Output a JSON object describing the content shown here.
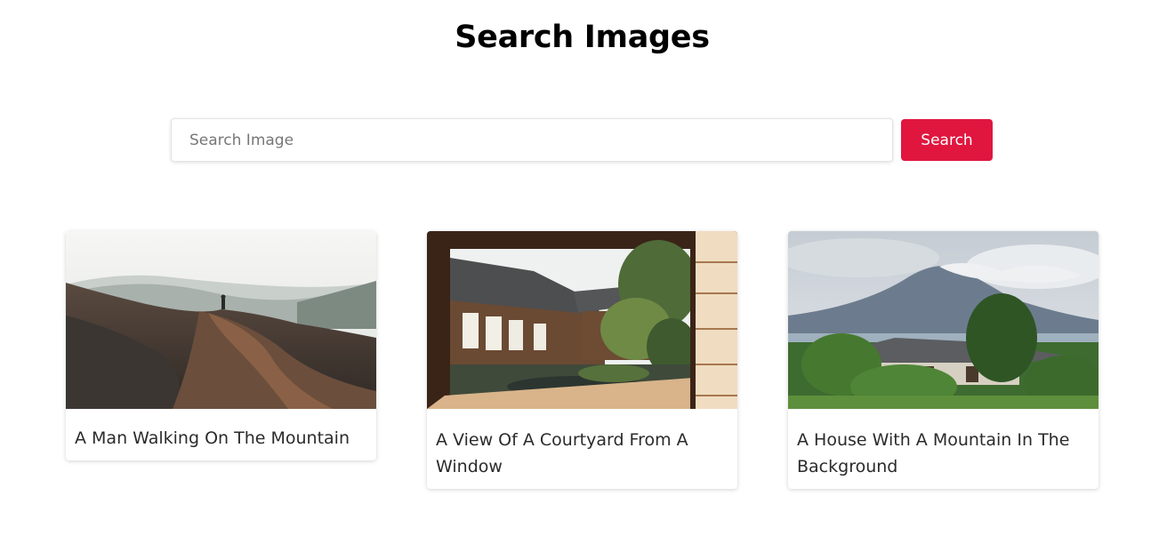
{
  "page": {
    "title": "Search Images"
  },
  "search": {
    "placeholder": "Search Image",
    "value": "",
    "button_label": "Search"
  },
  "colors": {
    "accent": "#e0163f",
    "title": "#000000",
    "caption": "#2b2b2b"
  },
  "results": [
    {
      "caption": "A Man Walking On The Mountain",
      "image": "man-on-mountain-photo"
    },
    {
      "caption": "A View Of A Courtyard From A Window",
      "image": "courtyard-window-photo"
    },
    {
      "caption": "A House With A Mountain In The Background",
      "image": "house-mountain-photo"
    }
  ]
}
